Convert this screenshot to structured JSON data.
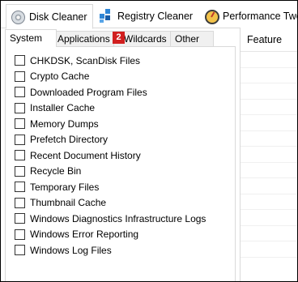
{
  "top_tabs": [
    {
      "label": "Disk Cleaner",
      "icon": "disk-cleaner-icon"
    },
    {
      "label": "Registry Cleaner",
      "icon": "registry-cleaner-icon"
    },
    {
      "label": "Performance Twe",
      "icon": "performance-icon"
    }
  ],
  "sub_tabs": [
    {
      "label": "System"
    },
    {
      "label": "Applications"
    },
    {
      "label": "Wildcards"
    },
    {
      "label": "Other"
    }
  ],
  "badge": "2",
  "items": [
    {
      "label": "CHKDSK, ScanDisk Files",
      "checked": false
    },
    {
      "label": "Crypto Cache",
      "checked": false
    },
    {
      "label": "Downloaded Program Files",
      "checked": false
    },
    {
      "label": "Installer Cache",
      "checked": false
    },
    {
      "label": "Memory Dumps",
      "checked": false
    },
    {
      "label": "Prefetch Directory",
      "checked": false
    },
    {
      "label": "Recent Document History",
      "checked": false
    },
    {
      "label": "Recycle Bin",
      "checked": false
    },
    {
      "label": "Temporary Files",
      "checked": false
    },
    {
      "label": "Thumbnail Cache",
      "checked": false
    },
    {
      "label": "Windows Diagnostics Infrastructure Logs",
      "checked": false
    },
    {
      "label": "Windows Error Reporting",
      "checked": false
    },
    {
      "label": "Windows Log Files",
      "checked": false
    }
  ],
  "feature_panel": {
    "header": "Feature"
  },
  "colors": {
    "badge": "#d11f1f",
    "border": "#d9d9d9"
  }
}
